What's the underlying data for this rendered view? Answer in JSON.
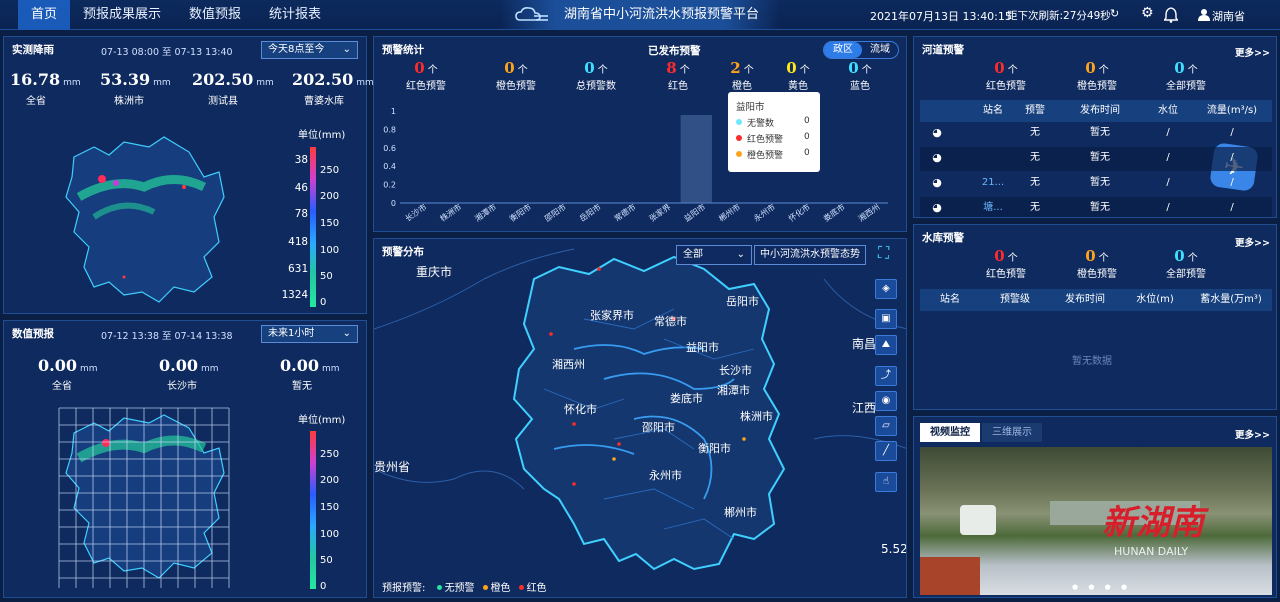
{
  "nav": {
    "items": [
      "首页",
      "预报成果展示",
      "数值预报",
      "统计报表"
    ],
    "active": "首页"
  },
  "app_title": "湖南省中小河流洪水预报预警平台",
  "header": {
    "datetime": "2021年07月13日 13:40:15",
    "refresh": "距下次刷新:27分49秒",
    "region": "湖南省"
  },
  "rain_panel": {
    "title": "实测降雨",
    "range": "07-13 08:00 至 07-13 13:40",
    "select": "今天8点至今",
    "stats": [
      {
        "value": "16.78",
        "unit": "mm",
        "label": "全省"
      },
      {
        "value": "53.39",
        "unit": "mm",
        "label": "株洲市"
      },
      {
        "value": "202.50",
        "unit": "mm",
        "label": "测试县"
      },
      {
        "value": "202.50",
        "unit": "mm",
        "label": "曹婆水库"
      }
    ],
    "legend_title": "单位(mm)",
    "legend_counts": [
      "38",
      "46",
      "78",
      "418",
      "631",
      "1324"
    ],
    "legend_ticks": [
      "250",
      "200",
      "150",
      "100",
      "50",
      "0"
    ]
  },
  "forecast_panel": {
    "title": "数值预报",
    "range": "07-12 13:38 至 07-14 13:38",
    "select": "未来1小时",
    "stats": [
      {
        "value": "0.00",
        "unit": "mm",
        "label": "全省"
      },
      {
        "value": "0.00",
        "unit": "mm",
        "label": "长沙市"
      },
      {
        "value": "0.00",
        "unit": "mm",
        "label": "暂无"
      }
    ],
    "legend_title": "单位(mm)",
    "legend_ticks": [
      "250",
      "200",
      "150",
      "100",
      "50",
      "0"
    ]
  },
  "warning_stats": {
    "title": "预警统计",
    "published_title": "已发布预警",
    "tabs": [
      "政区",
      "流域"
    ],
    "active_tab": "政区",
    "counts_left": [
      {
        "n": "0",
        "unit": "个",
        "label": "红色预警",
        "color": "#ff2b2b"
      },
      {
        "n": "0",
        "unit": "个",
        "label": "橙色预警",
        "color": "#ffa31a"
      },
      {
        "n": "0",
        "unit": "个",
        "label": "总预警数",
        "color": "#3fe0ff"
      }
    ],
    "counts_right": [
      {
        "n": "8",
        "unit": "个",
        "label": "红色",
        "color": "#ff2b2b"
      },
      {
        "n": "2",
        "unit": "个",
        "label": "橙色",
        "color": "#ffa31a"
      },
      {
        "n": "0",
        "unit": "个",
        "label": "黄色",
        "color": "#ffe81a"
      },
      {
        "n": "0",
        "unit": "个",
        "label": "蓝色",
        "color": "#3fe0ff"
      }
    ],
    "tooltip": {
      "title": "益阳市",
      "rows": [
        {
          "label": "无警数",
          "value": "0",
          "color": "#6ee7ff"
        },
        {
          "label": "红色预警",
          "value": "0",
          "color": "#ff2b2b"
        },
        {
          "label": "橙色预警",
          "value": "0",
          "color": "#ffa31a"
        }
      ]
    }
  },
  "chart_data": {
    "type": "bar",
    "categories": [
      "长沙市",
      "株洲市",
      "湘潭市",
      "衡阳市",
      "邵阳市",
      "岳阳市",
      "常德市",
      "张家界",
      "益阳市",
      "郴州市",
      "永州市",
      "怀化市",
      "娄底市",
      "湘西州"
    ],
    "series": [
      {
        "values": [
          0,
          0,
          0,
          0,
          0,
          0,
          0,
          0,
          0,
          0,
          0,
          0,
          0,
          0
        ]
      }
    ],
    "ylim": [
      0,
      1
    ],
    "yticks": [
      "0",
      "0.2",
      "0.4",
      "0.6",
      "0.8",
      "1"
    ],
    "highlight_category": "益阳市"
  },
  "distribution": {
    "title": "预警分布",
    "select": "全部",
    "link": "中小河流洪水预警态势",
    "outside_labels": [
      "重庆市",
      "贵州省",
      "南昌",
      "江西"
    ],
    "cities": [
      "张家界市",
      "常德市",
      "岳阳市",
      "益阳市",
      "湘西州",
      "长沙市",
      "湘潭市",
      "娄底市",
      "怀化市",
      "株洲市",
      "邵阳市",
      "衡阳市",
      "永州市",
      "郴州市"
    ],
    "scale": "5.52",
    "legend_label": "预报预警:",
    "legend": [
      {
        "label": "无预警",
        "color": "#28e0a0"
      },
      {
        "label": "橙色",
        "color": "#ffa31a"
      },
      {
        "label": "红色",
        "color": "#ff2b2b"
      }
    ]
  },
  "river_warning": {
    "title": "河道预警",
    "more": "更多>>",
    "counts": [
      {
        "n": "0",
        "unit": "个",
        "label": "红色预警",
        "color": "#ff2b2b"
      },
      {
        "n": "0",
        "unit": "个",
        "label": "橙色预警",
        "color": "#ffa31a"
      },
      {
        "n": "0",
        "unit": "个",
        "label": "全部预警",
        "color": "#3fe0ff"
      }
    ],
    "headers": [
      "站名",
      "预警",
      "发布时间",
      "水位",
      "流量(m³/s)"
    ],
    "rows": [
      {
        "name": "",
        "warn": "无",
        "time": "暂无",
        "level": "/",
        "flow": "/"
      },
      {
        "name": "",
        "warn": "无",
        "time": "暂无",
        "level": "/",
        "flow": "/"
      },
      {
        "name": "21...",
        "warn": "无",
        "time": "暂无",
        "level": "/",
        "flow": "/"
      },
      {
        "name": "塘...",
        "warn": "无",
        "time": "暂无",
        "level": "/",
        "flow": "/"
      }
    ]
  },
  "reservoir_warning": {
    "title": "水库预警",
    "more": "更多>>",
    "counts": [
      {
        "n": "0",
        "unit": "个",
        "label": "红色预警",
        "color": "#ff2b2b"
      },
      {
        "n": "0",
        "unit": "个",
        "label": "橙色预警",
        "color": "#ffa31a"
      },
      {
        "n": "0",
        "unit": "个",
        "label": "全部预警",
        "color": "#3fe0ff"
      }
    ],
    "headers": [
      "站名",
      "预警级",
      "发布时间",
      "水位(m)",
      "蓄水量(万m³)"
    ],
    "empty": "暂无数据"
  },
  "video": {
    "tabs": [
      "视频监控",
      "三维展示"
    ],
    "active": "视频监控",
    "more": "更多>>",
    "watermark": "新湖南",
    "watermark_en": "HUNAN DAILY"
  }
}
